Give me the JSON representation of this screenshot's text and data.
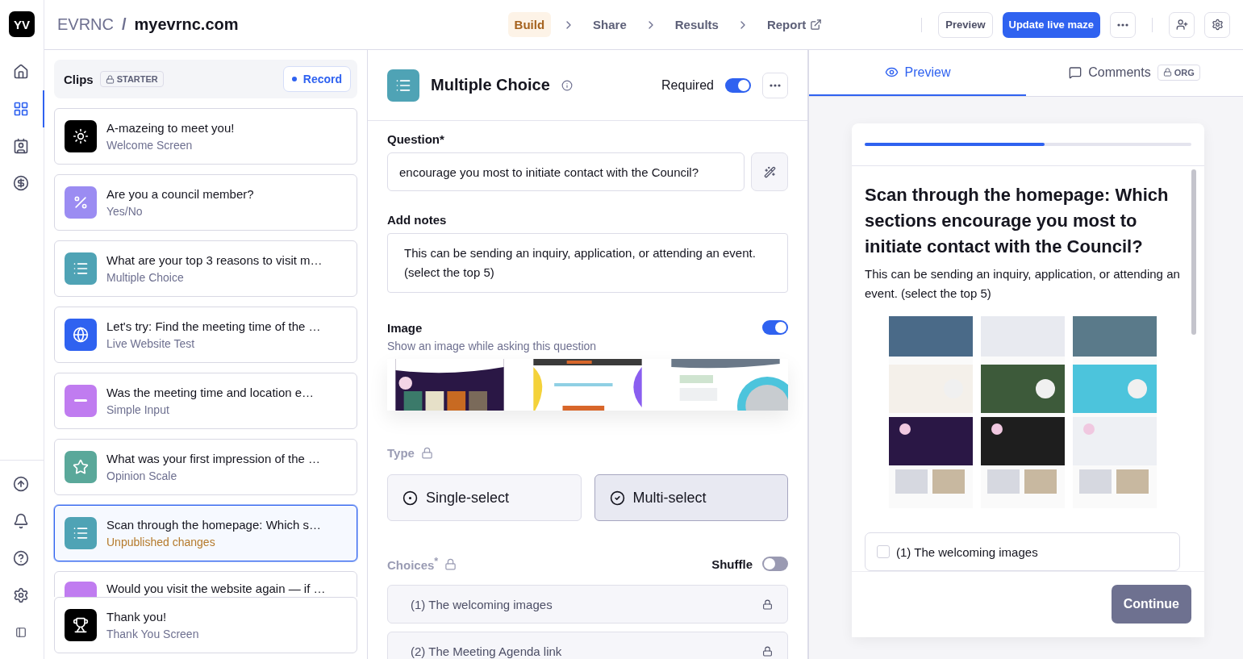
{
  "app": {
    "avatar": "YV",
    "workspace": "EVRNC",
    "separator": "/",
    "project": "myevrnc.com"
  },
  "rail": [
    {
      "kind": "home",
      "selected": false
    },
    {
      "kind": "grid",
      "selected": true
    },
    {
      "kind": "contacts",
      "selected": false
    },
    {
      "kind": "billing",
      "selected": false
    }
  ],
  "rail_bottom": [
    {
      "kind": "upload"
    },
    {
      "kind": "bell"
    },
    {
      "kind": "help"
    },
    {
      "kind": "settings"
    },
    {
      "kind": "panel"
    }
  ],
  "steps": [
    {
      "label": "Build",
      "selected": true,
      "external": false
    },
    {
      "label": "Share",
      "selected": false,
      "external": false
    },
    {
      "label": "Results",
      "selected": false,
      "external": false
    },
    {
      "label": "Report",
      "selected": false,
      "external": true
    }
  ],
  "actions": {
    "preview": "Preview",
    "publish": "Update live maze"
  },
  "clips": {
    "title": "Clips",
    "badge": "STARTER",
    "record": "Record"
  },
  "blocks": [
    {
      "title": "A-mazeing to meet you!",
      "subtitle": "Welcome Screen",
      "kind": "welcome",
      "color": "#000000",
      "selected": false
    },
    {
      "title": "Are you a council member?",
      "subtitle": "Yes/No",
      "kind": "yesno",
      "color": "#9b8cf2",
      "selected": false
    },
    {
      "title": "What are your top 3 reasons to visit m…",
      "subtitle": "Multiple Choice",
      "kind": "choice",
      "color": "#4fa3b5",
      "selected": false
    },
    {
      "title": "Let's try: Find the meeting time of the …",
      "subtitle": "Live Website Test",
      "kind": "website",
      "color": "#2f62f0",
      "selected": false
    },
    {
      "title": "Was the meeting time and location e…",
      "subtitle": "Simple Input",
      "kind": "input",
      "color": "#c07cf0",
      "selected": false
    },
    {
      "title": "What was your first impression of the …",
      "subtitle": "Opinion Scale",
      "kind": "scale",
      "color": "#5aa89a",
      "selected": false
    },
    {
      "title": "Scan through the homepage: Which s…",
      "subtitle": "Unpublished changes",
      "kind": "choice",
      "color": "#4fa3b5",
      "selected": true,
      "unpublished": true
    },
    {
      "title": "Would you visit the website again — if …",
      "kind": "input",
      "color": "#c07cf0",
      "selected": false,
      "partial": true
    }
  ],
  "end_block": {
    "title": "Thank you!",
    "subtitle": "Thank You Screen",
    "kind": "thankyou",
    "color": "#000000"
  },
  "editor": {
    "block_type": "Multiple Choice",
    "required_label": "Required",
    "required": true,
    "question_label": "Question*",
    "question": "encourage you most to initiate contact with the Council?",
    "notes_label": "Add notes",
    "notes": "This can be sending an inquiry, application, or attending an event. (select the top 5)",
    "image_label": "Image",
    "image_hint": "Show an image while asking this question",
    "image_on": true,
    "thumbnails": [
      {
        "kind": "picture"
      },
      {
        "kind": "picture"
      },
      {
        "kind": "picture"
      }
    ],
    "type_label": "Type",
    "types": [
      {
        "label": "Single-select",
        "kind": "radio",
        "selected": false
      },
      {
        "label": "Multi-select",
        "kind": "check",
        "selected": true
      }
    ],
    "choices_label": "Choices",
    "choices_mark": "*",
    "shuffle_label": "Shuffle",
    "shuffle": false,
    "choices": [
      "(1) The welcoming images",
      "(2) The Meeting Agenda link"
    ]
  },
  "preview_tabs": [
    {
      "label": "Preview",
      "kind": "eye",
      "selected": true
    },
    {
      "label": "Comments",
      "kind": "comment",
      "selected": false,
      "badge": "ORG"
    }
  ],
  "preview": {
    "level": 0.55,
    "title": "Scan through the homepage: Which sections encourage you most to initiate contact with the Council?",
    "notes": "This can be sending an inquiry, application, or attending an event. (select the top 5)",
    "options": [
      {
        "label": "(1) The welcoming images",
        "checked": false
      }
    ],
    "continue": "Continue"
  }
}
